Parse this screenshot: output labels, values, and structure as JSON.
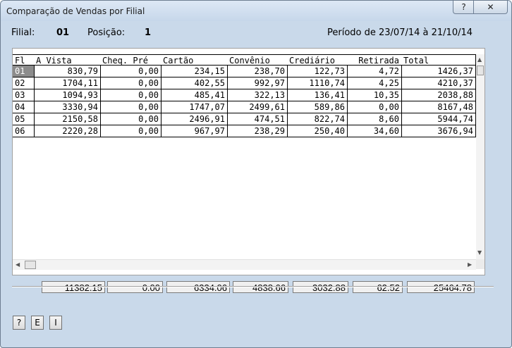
{
  "window": {
    "title": "Comparação de Vendas por Filial",
    "help_glyph": "?",
    "close_glyph": "✕"
  },
  "info": {
    "filial_label": "Filial:",
    "filial_value": "01",
    "posicao_label": "Posição:",
    "posicao_value": "1",
    "periodo": "Período de 23/07/14 à 21/10/14"
  },
  "table": {
    "headers": [
      "Fl",
      "A Vista",
      "Cheq. Pré",
      "Cartão",
      "Convênio",
      "Crediário",
      "Retirada",
      "Total"
    ],
    "rows": [
      [
        "01",
        "830,79",
        "0,00",
        "234,15",
        "238,70",
        "122,73",
        "4,72",
        "1426,37"
      ],
      [
        "02",
        "1704,11",
        "0,00",
        "402,55",
        "992,97",
        "1110,74",
        "4,25",
        "4210,37"
      ],
      [
        "03",
        "1094,93",
        "0,00",
        "485,41",
        "322,13",
        "136,41",
        "10,35",
        "2038,88"
      ],
      [
        "04",
        "3330,94",
        "0,00",
        "1747,07",
        "2499,61",
        "589,86",
        "0,00",
        "8167,48"
      ],
      [
        "05",
        "2150,58",
        "0,00",
        "2496,91",
        "474,51",
        "822,74",
        "8,60",
        "5944,74"
      ],
      [
        "06",
        "2220,28",
        "0,00",
        "967,97",
        "238,29",
        "250,40",
        "34,60",
        "3676,94"
      ]
    ],
    "selected_row": 0
  },
  "totals": [
    "11382.15",
    "0.00",
    "6334.06",
    "4838.66",
    "3032.88",
    "62.52",
    "25464.78"
  ],
  "buttons": {
    "help": "?",
    "e": "E",
    "i": "I"
  }
}
